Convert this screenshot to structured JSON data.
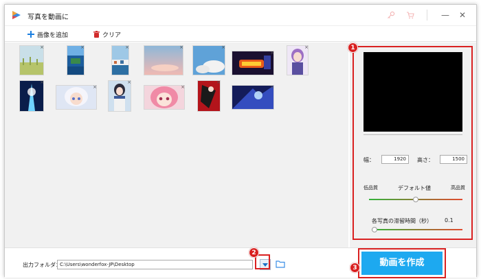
{
  "window": {
    "title": "写真を動画に"
  },
  "toolbar": {
    "add_label": "画像を追加",
    "clear_label": "クリア"
  },
  "thumbnails": [
    {
      "name": "grass-flowers",
      "close": "×"
    },
    {
      "name": "coast-island",
      "close": "×"
    },
    {
      "name": "harbor-town",
      "close": "×"
    },
    {
      "name": "pink-sky",
      "close": "×"
    },
    {
      "name": "blue-sky-clouds",
      "close": "×"
    },
    {
      "name": "neon-sign",
      "close": "×"
    },
    {
      "name": "anime-purple-girl",
      "close": "×"
    },
    {
      "name": "anime-blue-light",
      "close": "×"
    },
    {
      "name": "anime-white-hair",
      "close": "×"
    },
    {
      "name": "anime-winter-girl",
      "close": "×"
    },
    {
      "name": "anime-pink-hair",
      "close": "×"
    },
    {
      "name": "anime-red-black",
      "close": "×"
    },
    {
      "name": "anime-blue-abstract",
      "close": "×"
    }
  ],
  "settings": {
    "width_label": "幅：",
    "width_value": "1920",
    "height_label": "高さ：",
    "height_value": "1500",
    "quality_low": "低品質",
    "quality_default": "デフォルト値",
    "quality_high": "高品質",
    "quality_level": 0.5,
    "duration_label": "各写真の滞留時間（秒）",
    "duration_value": "0.1",
    "duration_level": 0.0
  },
  "output": {
    "label": "出力フォルダ：",
    "path": "C:\\Users\\wonderfox-JP\\Desktop"
  },
  "create_button": {
    "label": "動画を作成"
  },
  "badges": {
    "b1": "1",
    "b2": "2",
    "b3": "3"
  },
  "colors": {
    "accent": "#1da9f0",
    "highlight": "#d92020",
    "add_icon": "#1a7ee0",
    "clear_icon": "#d12b2b"
  }
}
